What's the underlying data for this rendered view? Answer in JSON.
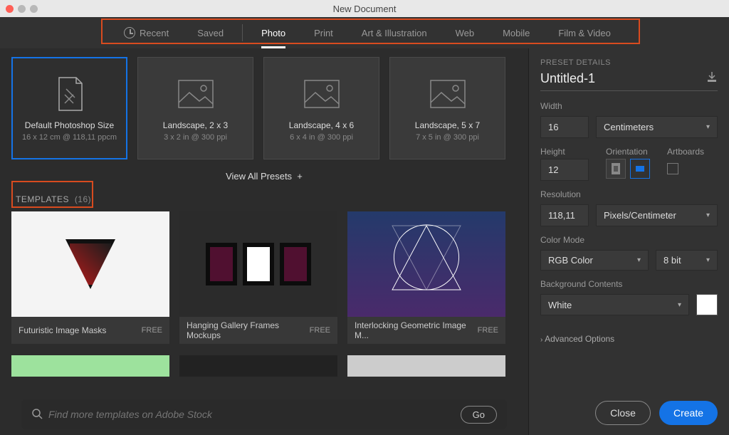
{
  "window": {
    "title": "New Document"
  },
  "tabs": {
    "recent": "Recent",
    "saved": "Saved",
    "photo": "Photo",
    "print": "Print",
    "art": "Art & Illustration",
    "web": "Web",
    "mobile": "Mobile",
    "film": "Film & Video",
    "active": "photo"
  },
  "presets": [
    {
      "name": "Default Photoshop Size",
      "sub": "16 x 12 cm @ 118,11 ppcm",
      "selected": true
    },
    {
      "name": "Landscape, 2 x 3",
      "sub": "3 x 2 in @ 300 ppi",
      "selected": false
    },
    {
      "name": "Landscape, 4 x 6",
      "sub": "6 x 4 in @ 300 ppi",
      "selected": false
    },
    {
      "name": "Landscape, 5 x 7",
      "sub": "7 x 5 in @ 300 ppi",
      "selected": false
    }
  ],
  "view_all": "View All Presets",
  "templates": {
    "heading": "TEMPLATES",
    "count": "(16)",
    "items": [
      {
        "title": "Futuristic Image Masks",
        "price": "FREE"
      },
      {
        "title": "Hanging Gallery Frames Mockups",
        "price": "FREE"
      },
      {
        "title": "Interlocking Geometric Image M...",
        "price": "FREE"
      }
    ]
  },
  "search": {
    "placeholder": "Find more templates on Adobe Stock",
    "go": "Go"
  },
  "details": {
    "heading": "PRESET DETAILS",
    "name": "Untitled-1",
    "width_label": "Width",
    "width_value": "16",
    "width_unit": "Centimeters",
    "height_label": "Height",
    "height_value": "12",
    "orientation_label": "Orientation",
    "artboards_label": "Artboards",
    "resolution_label": "Resolution",
    "resolution_value": "118,11",
    "resolution_unit": "Pixels/Centimeter",
    "colormode_label": "Color Mode",
    "colormode_value": "RGB Color",
    "depth_value": "8 bit",
    "bg_label": "Background Contents",
    "bg_value": "White",
    "advanced": "Advanced Options"
  },
  "buttons": {
    "close": "Close",
    "create": "Create"
  }
}
